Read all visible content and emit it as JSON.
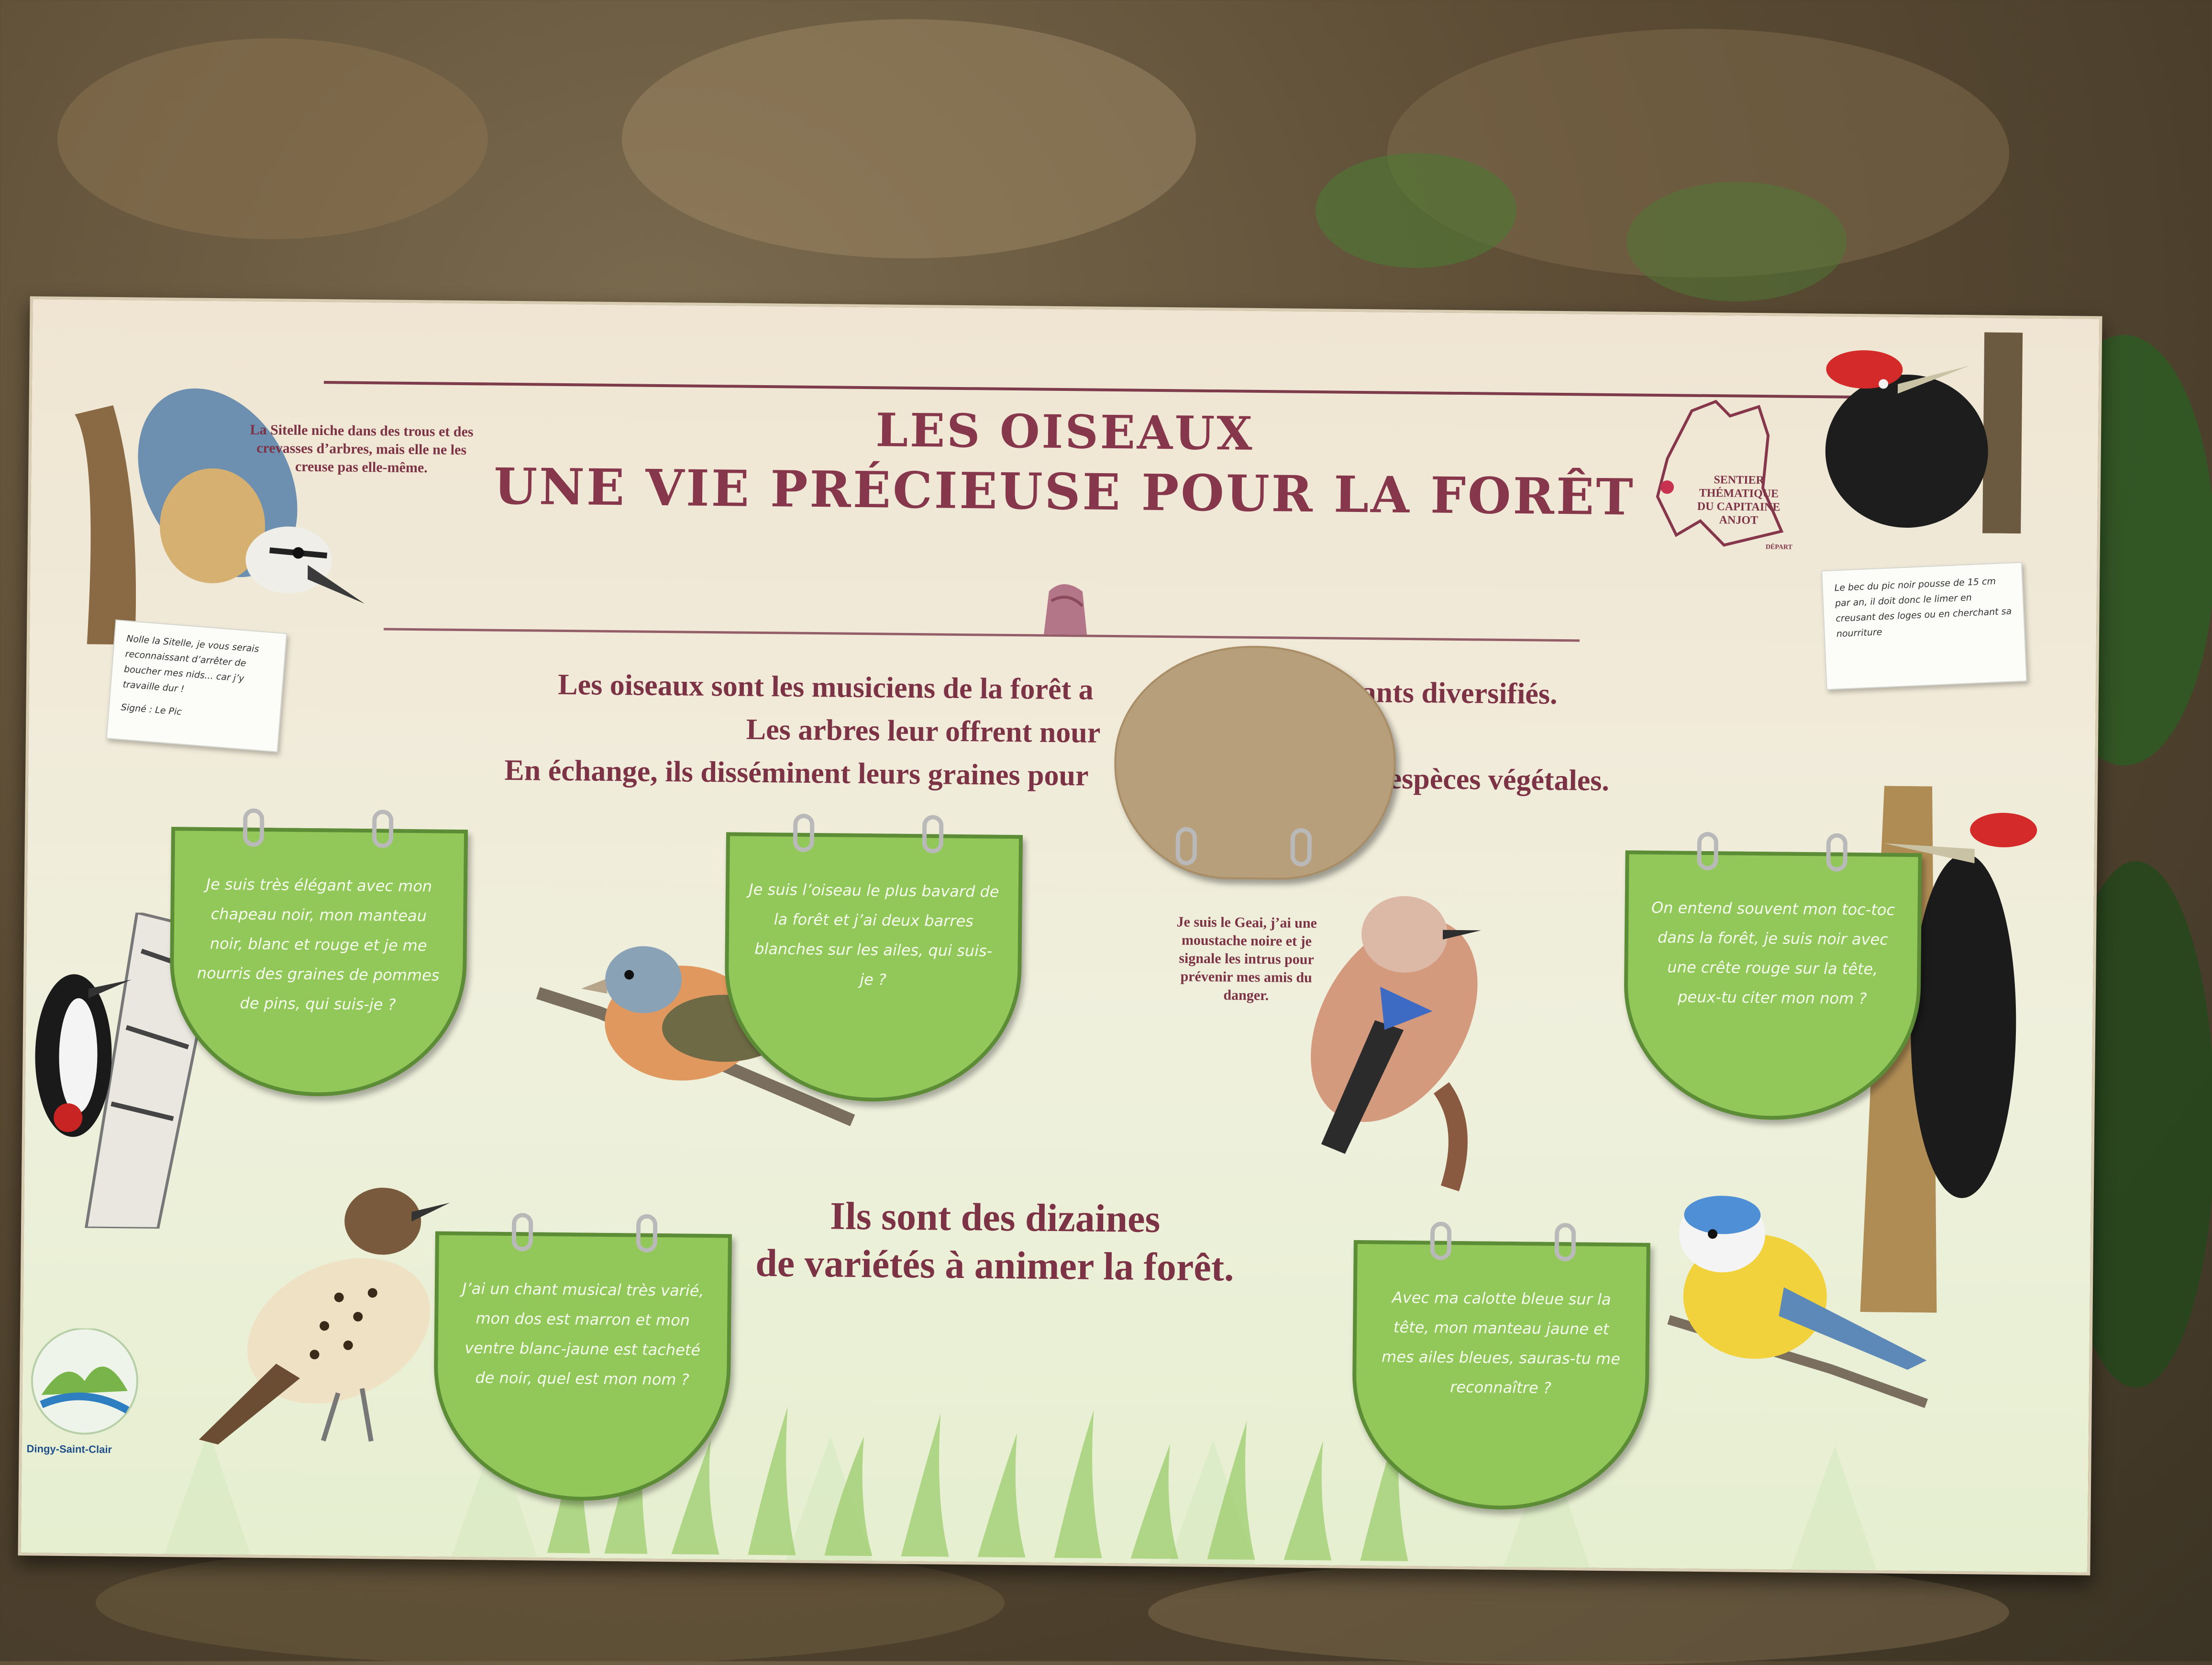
{
  "title": {
    "line1": "LES OISEAUX",
    "line2": "UNE VIE PRÉCIEUSE POUR LA FORÊT"
  },
  "intro": {
    "line1": "Les oiseaux sont les musiciens de la forêt a",
    "line1_end": "ants diversifiés.",
    "line2": "Les arbres leur offrent nour",
    "line3": "En échange, ils disséminent leurs graines pour",
    "line3_end": "es espèces végétales."
  },
  "trail_map": {
    "label": "SENTIER THÉMATIQUE DU CAPITAINE ANJOT",
    "start": "DÉPART"
  },
  "sitelle_note": "La Sitelle niche dans des trous et des crevasses d’arbres, mais elle ne les creuse pas elle-même.",
  "sitelle_card": {
    "text": "Nolle la Sitelle, je vous serais reconnaissant d’arrêter de boucher mes nids... car j’y travaille dur !",
    "signature": "Signé : Le Pic"
  },
  "pic_card": {
    "text": "Le bec du pic noir pousse de 15 cm par an, il doit donc le limer en creusant des loges ou en cherchant sa nourriture"
  },
  "geai_note": "Je suis le Geai, j’ai une moustache noire et je signale les intrus pour prévenir mes amis du danger.",
  "middle_text": {
    "line1": "Ils sont des dizaines",
    "line2": "de variétés à animer la forêt."
  },
  "quiz_discs": [
    {
      "id": "pic-epeiche",
      "text": "Je suis très élégant avec mon chapeau noir, mon manteau noir, blanc et rouge et je me nourris des graines de pommes de pins, qui suis-je ?"
    },
    {
      "id": "pinson",
      "text": "Je suis l’oiseau le plus bavard de la forêt et j’ai deux barres blanches sur les ailes, qui suis-je ?"
    },
    {
      "id": "pic-noir",
      "text": "On entend souvent mon toc-toc dans la forêt, je suis noir avec une crête rouge sur la tête, peux-tu citer mon nom ?"
    },
    {
      "id": "grive",
      "text": "J’ai un chant musical très varié, mon dos est marron et mon ventre blanc-jaune est tacheté de noir, quel est mon nom ?"
    },
    {
      "id": "mesange",
      "text": "Avec ma calotte bleue sur la tête, mon manteau jaune et mes ailes bleues, sauras-tu me reconnaître ?"
    }
  ],
  "logo": {
    "label": "Dingy-Saint-Clair"
  },
  "colors": {
    "title": "#86374c",
    "disc": "#92c85a",
    "board": "#efe5d2",
    "ground": "#5b4b34"
  }
}
